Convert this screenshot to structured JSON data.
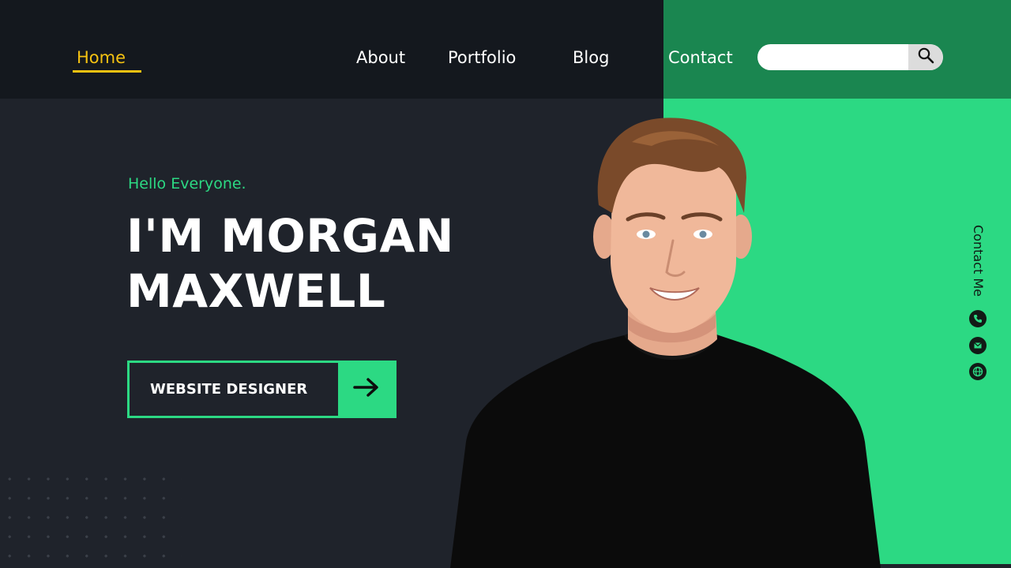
{
  "nav": {
    "items": [
      {
        "label": "Home",
        "active": true
      },
      {
        "label": "About"
      },
      {
        "label": "Portfolio"
      },
      {
        "label": "Blog"
      },
      {
        "label": "Contact"
      }
    ],
    "search": {
      "value": "",
      "placeholder": "",
      "icon": "search-icon"
    }
  },
  "hero": {
    "greeting": "Hello Everyone.",
    "name_line1": "I'M MORGAN",
    "name_line2": "MAXWELL",
    "cta_label": "WEBSITE DESIGNER",
    "cta_icon": "arrow-right-icon"
  },
  "sidebar": {
    "contact_label": "Contact Me",
    "icons": [
      "phone-icon",
      "mail-icon",
      "globe-icon"
    ]
  },
  "colors": {
    "accent": "#2cd983",
    "nav_active": "#f5c211",
    "dark_bg": "#1f232b",
    "nav_bg": "#14181e",
    "nav_green": "#1a8650"
  }
}
